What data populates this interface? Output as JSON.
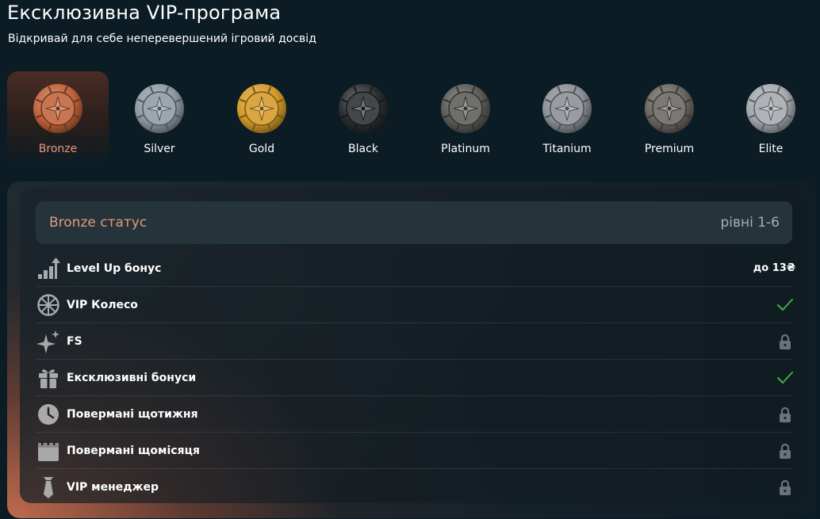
{
  "header": {
    "title": "Ексклюзивна VIP-програма",
    "subtitle": "Відкривай для себе неперевершений ігровий досвід"
  },
  "tiers": [
    {
      "label": "Bronze",
      "icon": "bronze-coin-icon",
      "active": true
    },
    {
      "label": "Silver",
      "icon": "silver-coin-icon",
      "active": false
    },
    {
      "label": "Gold",
      "icon": "gold-coin-icon",
      "active": false
    },
    {
      "label": "Black",
      "icon": "black-coin-icon",
      "active": false
    },
    {
      "label": "Platinum",
      "icon": "platinum-coin-icon",
      "active": false
    },
    {
      "label": "Titanium",
      "icon": "titanium-coin-icon",
      "active": false
    },
    {
      "label": "Premium",
      "icon": "premium-coin-icon",
      "active": false
    },
    {
      "label": "Elite",
      "icon": "elite-coin-icon",
      "active": false
    }
  ],
  "status": {
    "name": "Bronze статус",
    "levels": "рівні 1-6"
  },
  "benefits": [
    {
      "label": "Level Up бонус",
      "icon": "level-up-icon",
      "value": "до 13₴",
      "state": "value"
    },
    {
      "label": "VIP Колесо",
      "icon": "wheel-icon",
      "value": "",
      "state": "available"
    },
    {
      "label": "FS",
      "icon": "sparkle-icon",
      "value": "",
      "state": "locked"
    },
    {
      "label": "Ексклюзивні бонуси",
      "icon": "gift-icon",
      "value": "",
      "state": "available"
    },
    {
      "label": "Повермані щотижня",
      "icon": "clock-icon",
      "value": "",
      "state": "locked"
    },
    {
      "label": "Повермані щомісяця",
      "icon": "calendar-icon",
      "value": "",
      "state": "locked"
    },
    {
      "label": "VIP менеджер",
      "icon": "tie-icon",
      "value": "",
      "state": "locked"
    }
  ],
  "colors": {
    "accent": "#e39b7b",
    "check": "#3cb043",
    "lock": "#6b7378",
    "bronze": "#c0623a",
    "silver": "#8e9aa3",
    "gold": "#d49a28",
    "black": "#2a2d30",
    "platinum": "#5a5c58",
    "titanium": "#8b9096",
    "premium": "#6a6662",
    "elite": "#a4a9ae"
  }
}
